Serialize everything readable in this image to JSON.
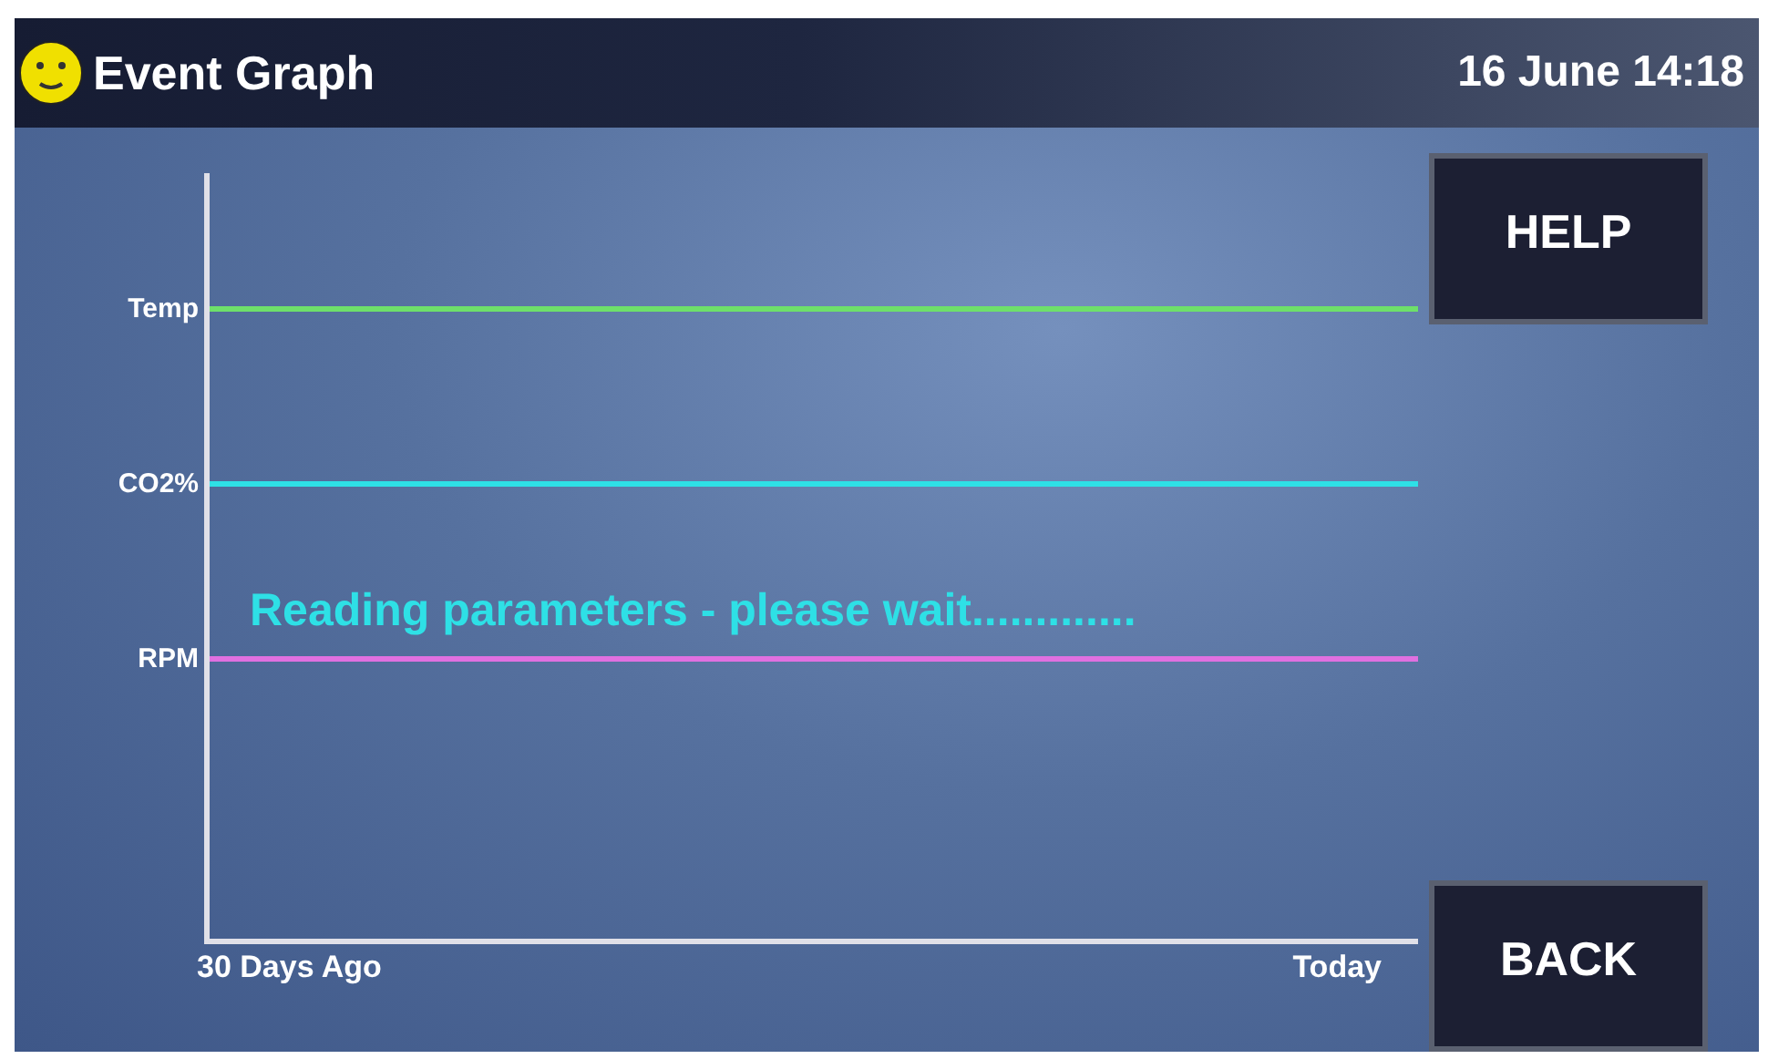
{
  "header": {
    "title": "Event Graph",
    "datetime": "16 June 14:18"
  },
  "graph": {
    "traces": [
      {
        "label": "Temp",
        "color": "#6ee06a"
      },
      {
        "label": "CO2%",
        "color": "#2ee0e6"
      },
      {
        "label": "RPM",
        "color": "#e070e0"
      }
    ],
    "status": "Reading parameters - please wait.............",
    "x_start": "30 Days Ago",
    "x_end": "Today"
  },
  "buttons": [
    {
      "label": "HELP"
    },
    {
      "label": "BACK"
    }
  ]
}
